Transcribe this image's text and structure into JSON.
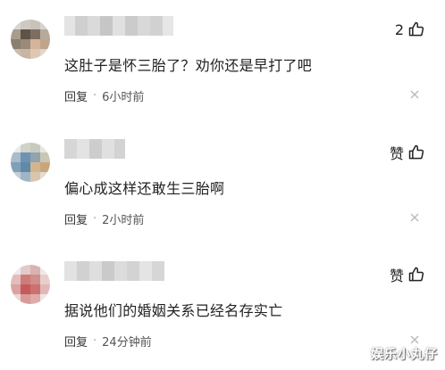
{
  "comments": [
    {
      "likes": "2",
      "text": "这肚子是怀三胎了？劝你还是早打了吧",
      "reply_label": "回复",
      "separator": "·",
      "time": "6小时前"
    },
    {
      "likes": "赞",
      "text": "偏心成这样还敢生三胎啊",
      "reply_label": "回复",
      "separator": "·",
      "time": "2小时前"
    },
    {
      "likes": "赞",
      "text": "据说他们的婚姻关系已经名存实亡",
      "reply_label": "回复",
      "separator": "·",
      "time": "24分钟前"
    }
  ],
  "watermark": "娱乐小丸仔",
  "icons": {
    "like": "thumb-up-icon",
    "close": "close-icon",
    "avatar": "blurred-avatar"
  },
  "colors": {
    "text": "#222222",
    "meta": "#555555",
    "close": "#bbbbbb"
  }
}
